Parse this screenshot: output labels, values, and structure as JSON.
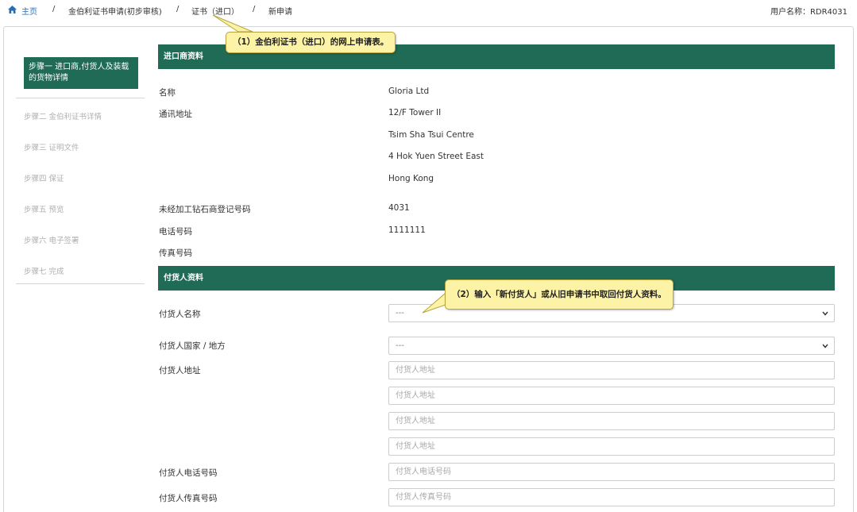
{
  "breadcrumb": {
    "home": "主页",
    "separator": "/",
    "item1": "金伯利证书申请(初步审核)",
    "item2": "证书（进口）",
    "item3": "新申请"
  },
  "user": {
    "label": "用户名称：RDR4031"
  },
  "steps": {
    "active": "步骤一 进口商,付货人及装载的货物详情",
    "items": [
      "步骤二 金伯利证书详情",
      "步骤三 证明文件",
      "步骤四 保证",
      "步骤五 预览",
      "步骤六 电子签署",
      "步骤七 完成"
    ]
  },
  "importer": {
    "section_title": "进口商资料",
    "name_label": "名称",
    "name_value": "Gloria Ltd",
    "address_label": "通讯地址",
    "address_lines": [
      "12/F Tower II",
      "Tsim Sha Tsui Centre",
      "4 Hok Yuen Street East",
      "Hong Kong"
    ],
    "reg_label": "未经加工钻石商登记号码",
    "reg_value": "4031",
    "phone_label": "电话号码",
    "phone_value": "1111111",
    "fax_label": "传真号码"
  },
  "consignor": {
    "section_title": "付货人资料",
    "name_label": "付货人名称",
    "name_select": "---",
    "country_label": "付货人国家 / 地方",
    "country_select": "---",
    "address_label": "付货人地址",
    "address_placeholder": "付货人地址",
    "phone_label": "付货人电话号码",
    "phone_placeholder": "付货人电话号码",
    "fax_label": "付货人传真号码",
    "fax_placeholder": "付货人传真号码"
  },
  "callouts": {
    "one": "（1）金伯利证书（进口）的网上申请表。",
    "two": "（2）输入「新付货人」或从旧申请书中取回付货人资料。"
  },
  "colors": {
    "accent": "#1f6b55",
    "link": "#2a6db5",
    "callout_bg": "#fdf3a6"
  }
}
